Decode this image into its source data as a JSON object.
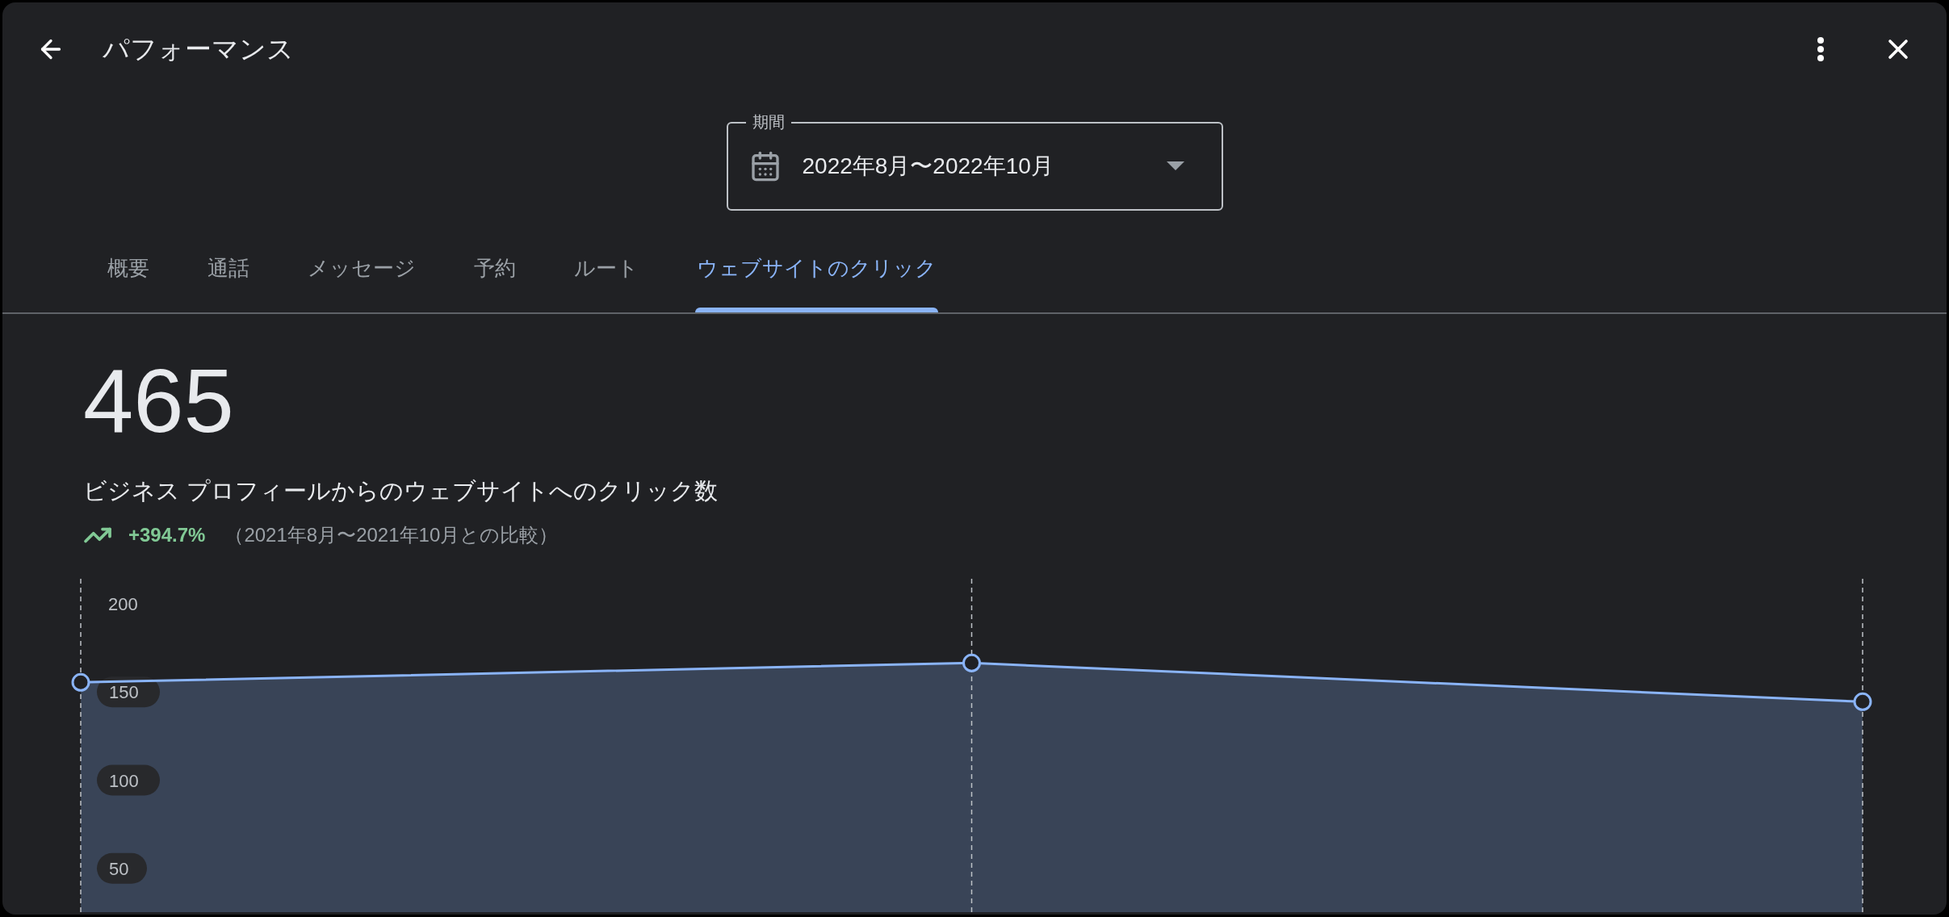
{
  "header": {
    "title": "パフォーマンス"
  },
  "period_field": {
    "label": "期間",
    "value": "2022年8月〜2022年10月"
  },
  "tabs": [
    {
      "label": "概要",
      "selected": false
    },
    {
      "label": "通話",
      "selected": false
    },
    {
      "label": "メッセージ",
      "selected": false
    },
    {
      "label": "予約",
      "selected": false
    },
    {
      "label": "ルート",
      "selected": false
    },
    {
      "label": "ウェブサイトのクリック",
      "selected": true
    }
  ],
  "summary": {
    "total": "465",
    "description": "ビジネス プロフィールからのウェブサイトへのクリック数",
    "change": "+394.7%",
    "comparison": "（2021年8月〜2021年10月との比較）"
  },
  "chart_data": {
    "type": "area",
    "series": [
      {
        "color": "#8ab4f8",
        "values": [
          155,
          166,
          144
        ]
      }
    ],
    "ylim": [
      0,
      200
    ],
    "yticks": [
      50,
      100,
      150,
      200
    ]
  }
}
